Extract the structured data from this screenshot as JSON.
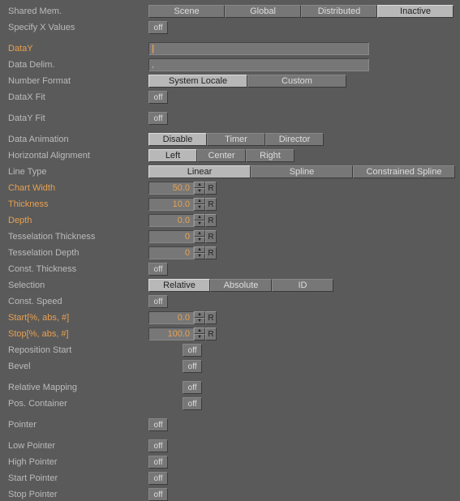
{
  "shared_mem": {
    "label": "Shared Mem.",
    "opts": [
      "Scene",
      "Global",
      "Distributed",
      "Inactive"
    ],
    "sel": 3
  },
  "specify_x": {
    "label": "Specify X Values",
    "val": "off"
  },
  "datay": {
    "label": "DataY",
    "val": ""
  },
  "data_delim": {
    "label": "Data Delim.",
    "val": ","
  },
  "num_format": {
    "label": "Number Format",
    "opts": [
      "System Locale",
      "Custom"
    ],
    "sel": 0
  },
  "datax_fit": {
    "label": "DataX Fit",
    "val": "off"
  },
  "datay_fit": {
    "label": "DataY Fit",
    "val": "off"
  },
  "data_anim": {
    "label": "Data Animation",
    "opts": [
      "Disable",
      "Timer",
      "Director"
    ],
    "sel": 0
  },
  "halign": {
    "label": "Horizontal Alignment",
    "opts": [
      "Left",
      "Center",
      "Right"
    ],
    "sel": 0
  },
  "line_type": {
    "label": "Line Type",
    "opts": [
      "Linear",
      "Spline",
      "Constrained Spline"
    ],
    "sel": 0
  },
  "chart_width": {
    "label": "Chart Width",
    "val": "50.0"
  },
  "thickness": {
    "label": "Thickness",
    "val": "10.0"
  },
  "depth": {
    "label": "Depth",
    "val": "0.0"
  },
  "tess_thick": {
    "label": "Tesselation Thickness",
    "val": "0"
  },
  "tess_depth": {
    "label": "Tesselation Depth",
    "val": "0"
  },
  "const_thick": {
    "label": "Const. Thickness",
    "val": "off"
  },
  "selection": {
    "label": "Selection",
    "opts": [
      "Relative",
      "Absolute",
      "ID"
    ],
    "sel": 0
  },
  "const_speed": {
    "label": "Const. Speed",
    "val": "off"
  },
  "start": {
    "label": "Start[%, abs, #]",
    "val": "0.0"
  },
  "stop": {
    "label": "Stop[%, abs, #]",
    "val": "100.0"
  },
  "repos_start": {
    "label": "Reposition Start",
    "val": "off"
  },
  "bevel": {
    "label": "Bevel",
    "val": "off"
  },
  "rel_map": {
    "label": "Relative Mapping",
    "val": "off"
  },
  "pos_cont": {
    "label": "Pos. Container",
    "val": "off"
  },
  "pointer": {
    "label": "Pointer",
    "val": "off"
  },
  "low_ptr": {
    "label": "Low Pointer",
    "val": "off"
  },
  "high_ptr": {
    "label": "High Pointer",
    "val": "off"
  },
  "start_ptr": {
    "label": "Start Pointer",
    "val": "off"
  },
  "stop_ptr": {
    "label": "Stop Pointer",
    "val": "off"
  },
  "r": "R"
}
